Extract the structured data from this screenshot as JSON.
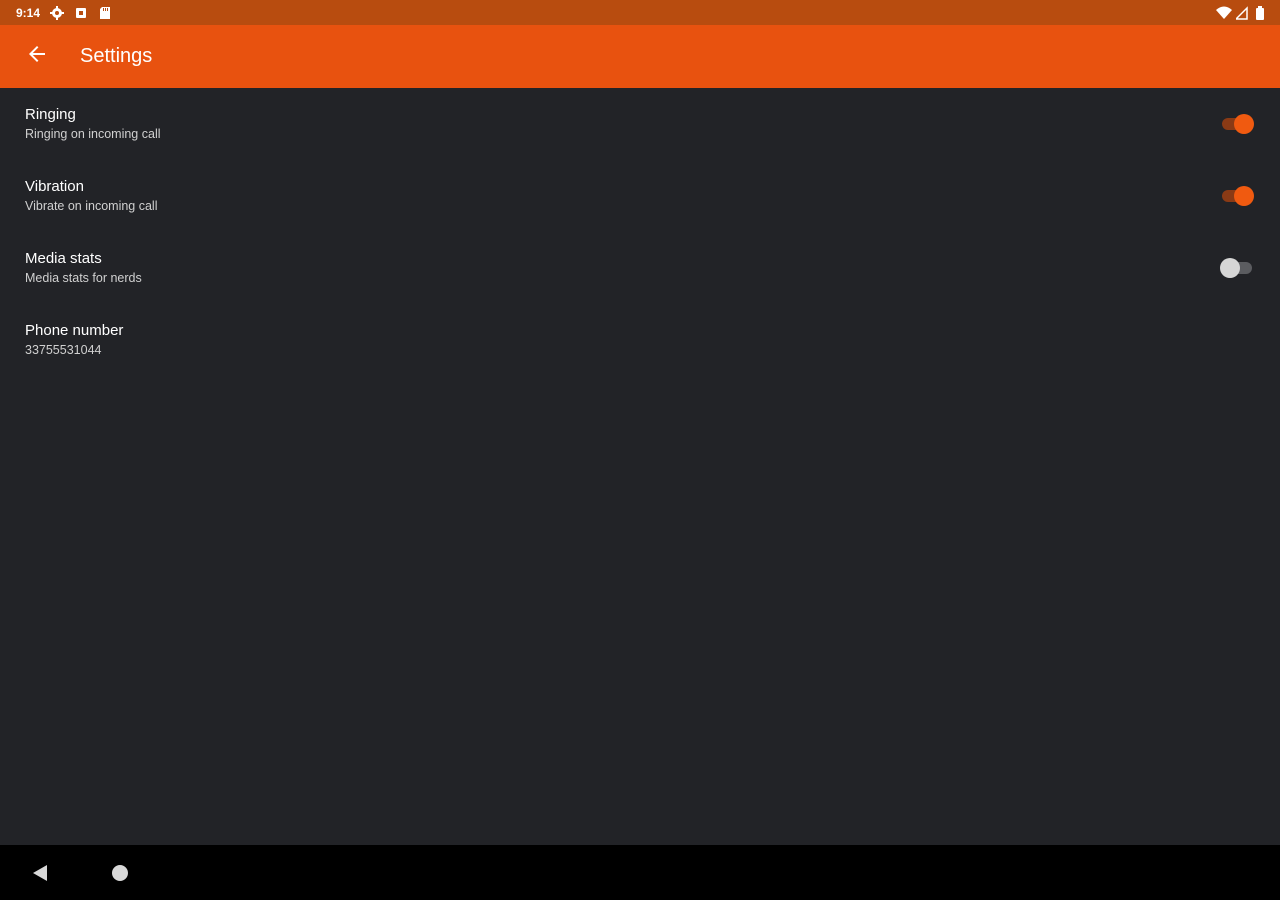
{
  "status_bar": {
    "time": "9:14",
    "left_icons": [
      "gear-icon",
      "notification-icon",
      "sd-card-icon"
    ],
    "right_icons": [
      "wifi-icon",
      "signal-icon",
      "battery-icon"
    ]
  },
  "app_bar": {
    "title": "Settings",
    "back_icon": "arrow-back-icon",
    "background": "#e8520f"
  },
  "settings": [
    {
      "title": "Ringing",
      "summary": "Ringing on incoming call",
      "switch": "on"
    },
    {
      "title": "Vibration",
      "summary": "Vibrate on incoming call",
      "switch": "on"
    },
    {
      "title": "Media stats",
      "summary": "Media stats for nerds",
      "switch": "off"
    },
    {
      "title": "Phone number",
      "summary": "33755531044"
    }
  ],
  "nav_bar": {
    "buttons": [
      "back-triangle-icon",
      "home-circle-icon"
    ]
  },
  "colors": {
    "accent": "#f05a10",
    "background": "#222327",
    "status_bar": "#b84c0f"
  }
}
